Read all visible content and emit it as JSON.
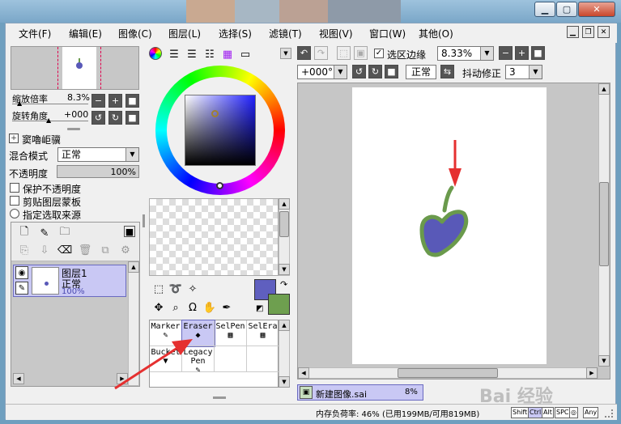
{
  "menu": [
    "文件(F)",
    "编辑(E)",
    "图像(C)",
    "图层(L)",
    "选择(S)",
    "滤镜(T)",
    "视图(V)",
    "窗口(W)",
    "其他(O)"
  ],
  "navigator": {
    "zoom_label": "缩放倍率",
    "zoom_value": "8.3%",
    "rotate_label": "旋转角度",
    "rotate_value": "+000"
  },
  "layer_props": {
    "header": "窦嚕岠骥",
    "blend_label": "混合模式",
    "blend_value": "正常",
    "opacity_label": "不透明度",
    "opacity_value": "100%",
    "opacity_fraction": 1.0,
    "option_protect": "保护不透明度",
    "option_clip": "剪贴图层蒙板",
    "option_source": "指定选取来源"
  },
  "layer": {
    "name": "图层1",
    "mode": "正常",
    "opacity": "100%"
  },
  "tools": [
    {
      "name": "Marker",
      "icon": "✎"
    },
    {
      "name": "Eraser",
      "icon": "◆",
      "selected": true
    },
    {
      "name": "SelPen",
      "icon": "▦"
    },
    {
      "name": "SelEra",
      "icon": "▦"
    },
    {
      "name": "Bucket",
      "icon": "▼"
    },
    {
      "name": "Legacy Pen",
      "icon": "✎"
    }
  ],
  "canvas_toolbar": {
    "selection_edge_label": "选区边缘",
    "zoom_value": "8.33%",
    "rotation_value": "+000°",
    "blend_value": "正常",
    "stabilizer_label": "抖动修正",
    "stabilizer_value": "3"
  },
  "document_tab": {
    "name": "新建图像.sai",
    "zoom": "8%"
  },
  "status": {
    "memory": "内存负荷率: 46% (已用199MB/可用819MB)",
    "keys": [
      "Shift",
      "Ctrl",
      "Alt",
      "SPC",
      "◎",
      "Any"
    ],
    "watermark": "Bai 经验"
  },
  "colors": {
    "primary": "#5f5fbf",
    "secondary": "#6e9f4f",
    "stroke_green": "#6a9a4c",
    "fill_purple": "#5959b8",
    "annotation_red": "#e53030"
  }
}
